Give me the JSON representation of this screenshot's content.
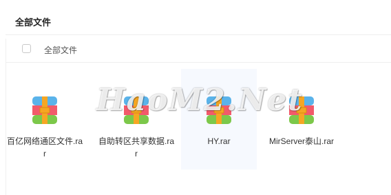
{
  "header": {
    "title": "全部文件"
  },
  "list_header": {
    "select_all_label": "全部文件"
  },
  "watermark": "HaoM2.Net",
  "files": [
    {
      "name": "百亿网络通区文件.rar",
      "icon": "rar-archive-icon"
    },
    {
      "name": "自助转区共享数据.rar",
      "icon": "rar-archive-icon"
    },
    {
      "name": "HY.rar",
      "icon": "rar-archive-icon"
    },
    {
      "name": "MirServer泰山.rar",
      "icon": "rar-archive-icon"
    }
  ],
  "colors": {
    "rar_top": "#5ab3ea",
    "rar_middle": "#f25a6b",
    "rar_bottom": "#7cc84a",
    "rar_band": "#f5a623"
  }
}
